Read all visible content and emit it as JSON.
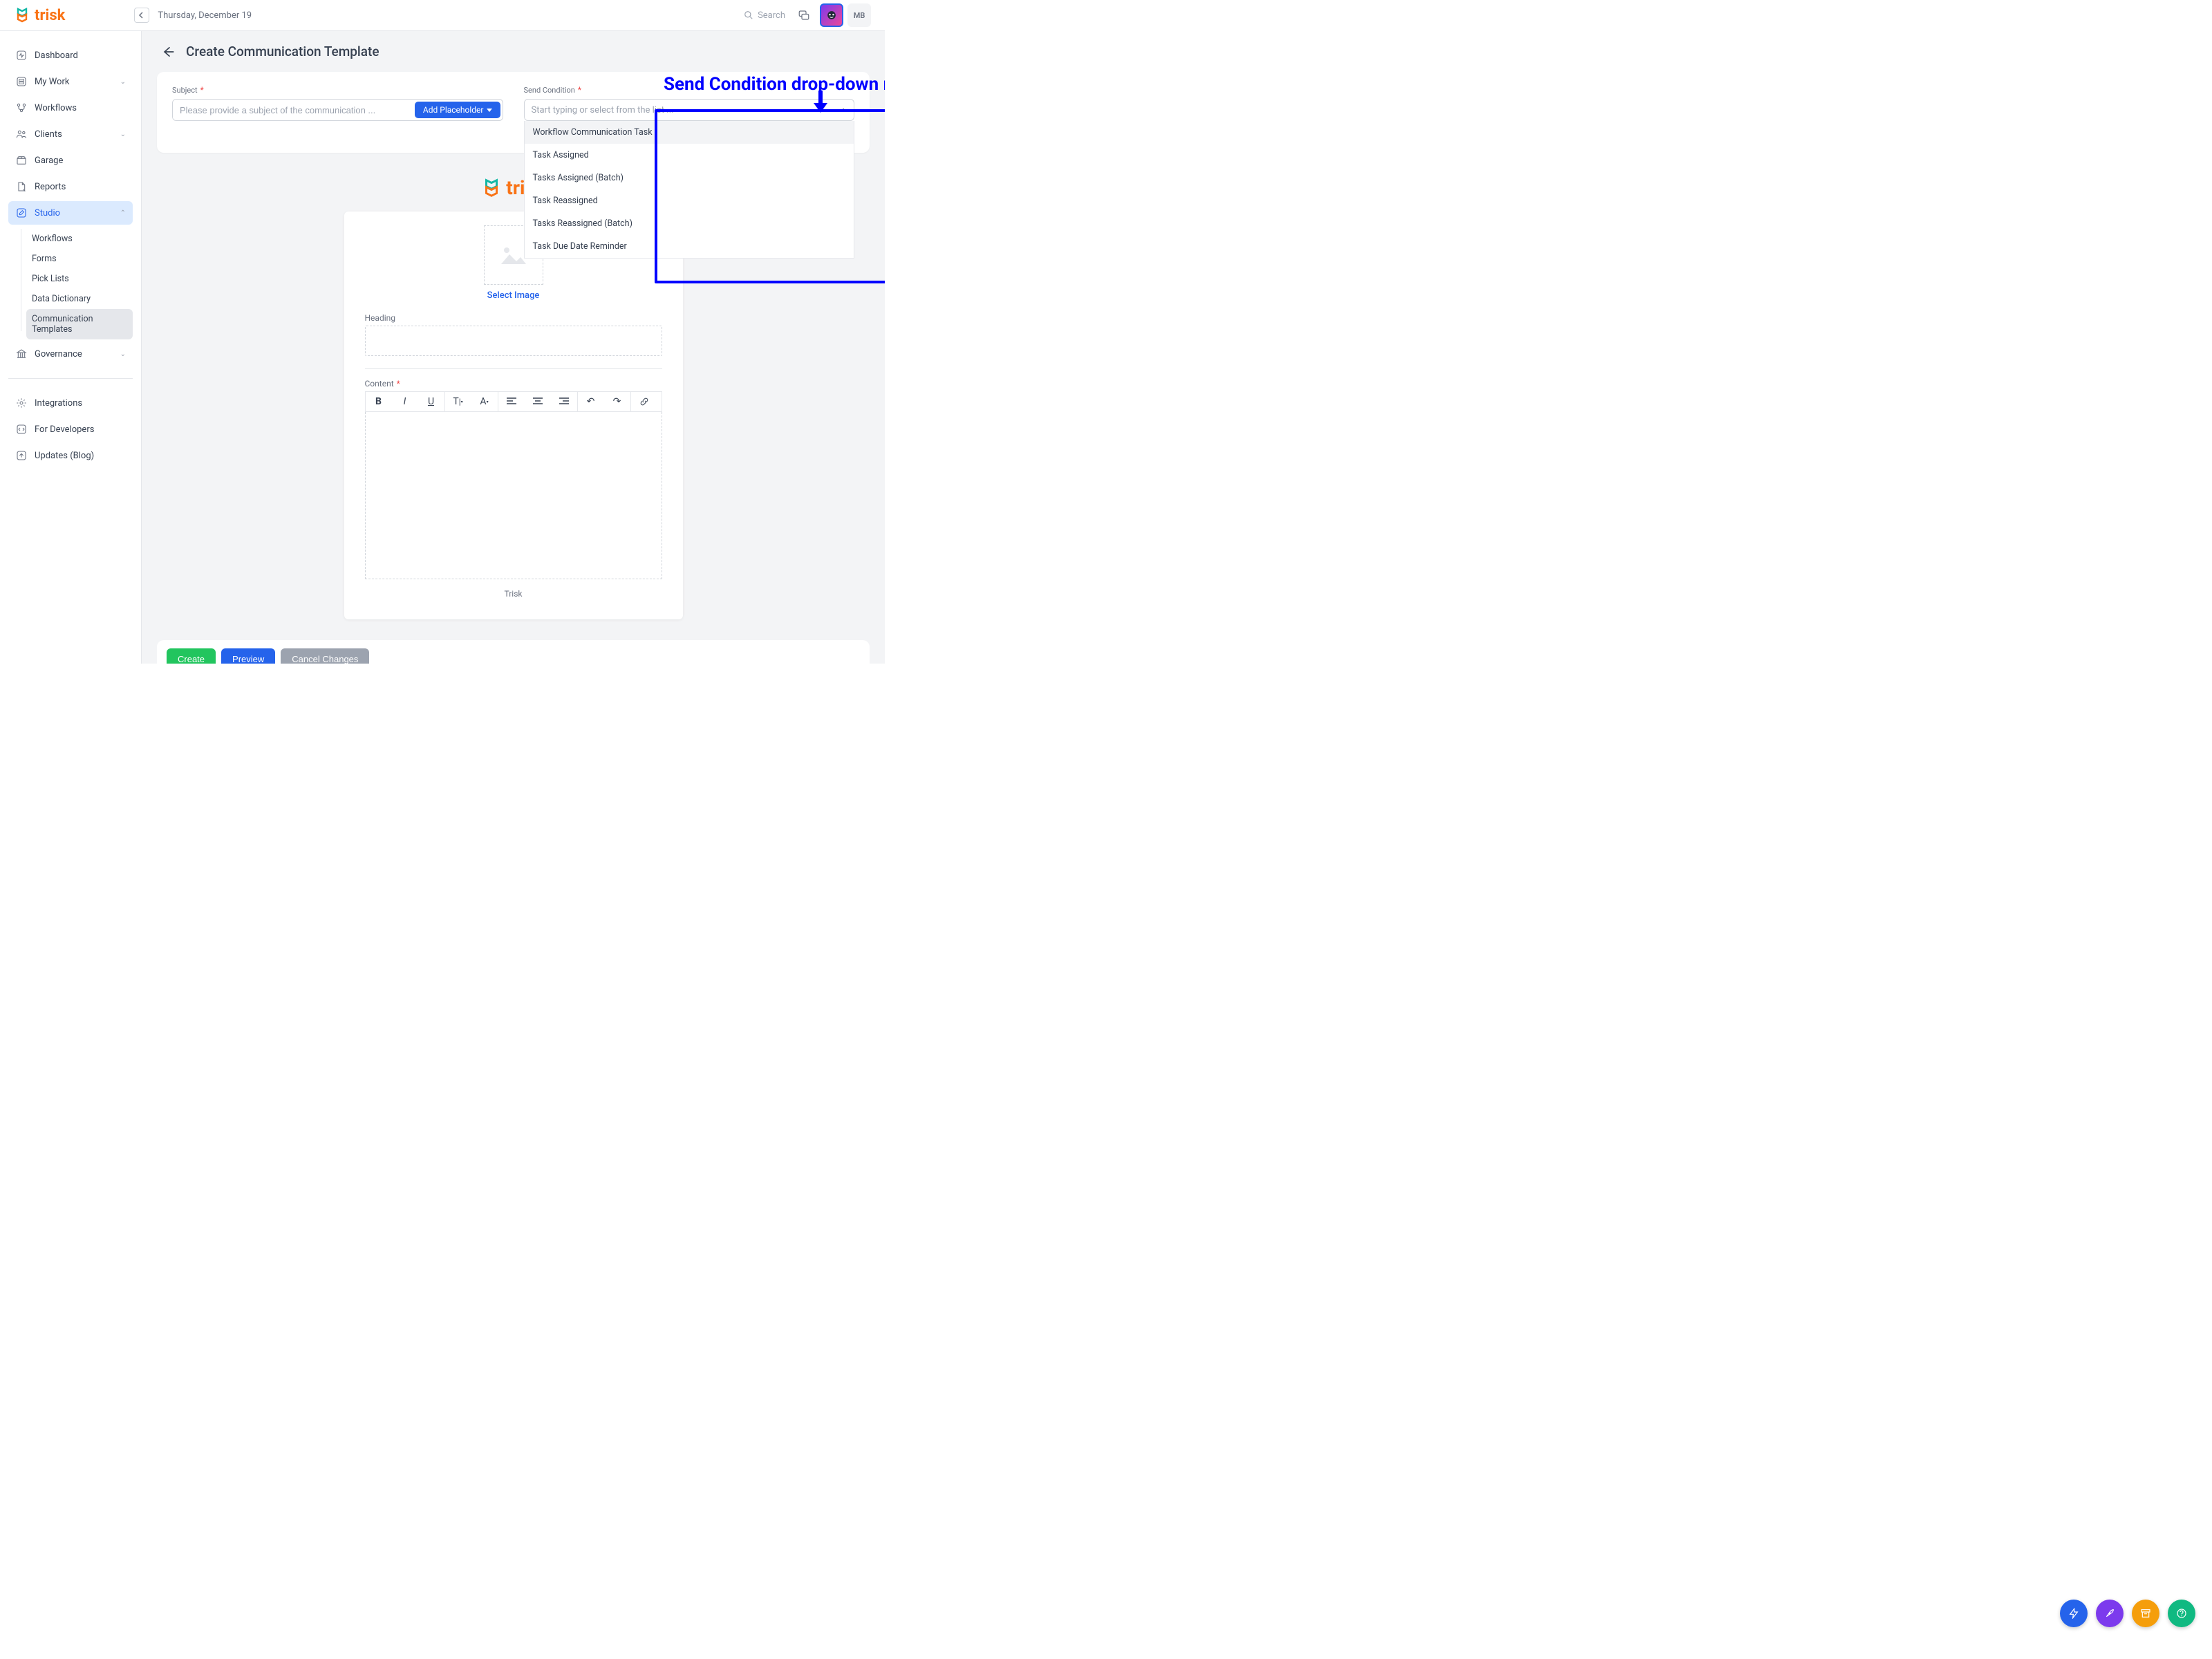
{
  "brand": {
    "name": "trisk",
    "color1": "#14b8a6",
    "color2": "#f97316"
  },
  "date": "Thursday, December 19",
  "search_placeholder": "Search",
  "user_initials": "MB",
  "sidebar": {
    "items": [
      {
        "label": "Dashboard",
        "icon": "activity"
      },
      {
        "label": "My Work",
        "icon": "cards",
        "expandable": true
      },
      {
        "label": "Workflows",
        "icon": "branch"
      },
      {
        "label": "Clients",
        "icon": "people",
        "expandable": true
      },
      {
        "label": "Garage",
        "icon": "box"
      },
      {
        "label": "Reports",
        "icon": "doc"
      },
      {
        "label": "Studio",
        "icon": "pencil",
        "expandable": true,
        "open": true,
        "active": true
      },
      {
        "label": "Governance",
        "icon": "bank",
        "expandable": true
      }
    ],
    "studio_sub": [
      {
        "label": "Workflows"
      },
      {
        "label": "Forms"
      },
      {
        "label": "Pick Lists"
      },
      {
        "label": "Data Dictionary"
      },
      {
        "label": "Communication Templates",
        "selected": true
      }
    ],
    "lower": [
      {
        "label": "Integrations",
        "icon": "gear"
      },
      {
        "label": "For Developers",
        "icon": "code"
      },
      {
        "label": "Updates (Blog)",
        "icon": "up"
      }
    ]
  },
  "page": {
    "title": "Create Communication Template"
  },
  "annotation": "Send Condition drop-down menu",
  "form": {
    "subject_label": "Subject",
    "subject_placeholder": "Please provide a subject of the communication ...",
    "add_placeholder_btn": "Add Placeholder",
    "send_condition_label": "Send Condition",
    "send_condition_placeholder": "Start typing or select from the list ...",
    "dropdown_options": [
      "Workflow Communication Task",
      "Task Assigned",
      "Tasks Assigned (Batch)",
      "Task Reassigned",
      "Tasks Reassigned (Batch)",
      "Task Due Date Reminder"
    ]
  },
  "editor": {
    "select_image": "Select Image",
    "heading_label": "Heading",
    "content_label": "Content",
    "footer_name": "Trisk"
  },
  "buttons": {
    "create": "Create",
    "preview": "Preview",
    "cancel": "Cancel Changes"
  }
}
